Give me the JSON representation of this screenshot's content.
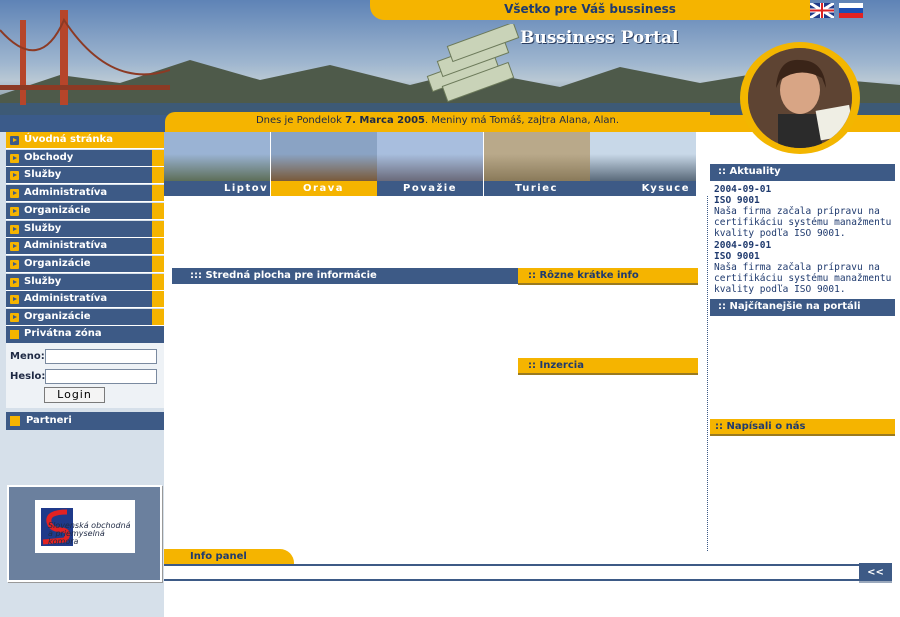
{
  "header": {
    "tagline": "Všetko pre Váš bussiness",
    "brand": "Bussiness Portal",
    "date_prefix": "Dnes je Pondelok ",
    "date_value": "7. Marca 2005",
    "date_suffix": ". Meniny má Tomáš, zajtra Alana, Alan.",
    "flags": [
      "english-flag",
      "slovak-flag"
    ]
  },
  "nav": {
    "items": [
      {
        "label": "Úvodná stránka",
        "active": true
      },
      {
        "label": "Obchody"
      },
      {
        "label": "Služby"
      },
      {
        "label": "Administratíva"
      },
      {
        "label": "Organizácie"
      },
      {
        "label": "Služby"
      },
      {
        "label": "Administratíva"
      },
      {
        "label": "Organizácie"
      },
      {
        "label": "Služby"
      },
      {
        "label": "Administratíva"
      },
      {
        "label": "Organizácie"
      }
    ],
    "private_zone": "Privátna zóna"
  },
  "login": {
    "name_label": "Meno:",
    "password_label": "Heslo:",
    "name_value": "",
    "password_value": "",
    "button": "Login"
  },
  "partners": {
    "title": "Partneri",
    "logo_text": "Slovenská obchodná a priemyselná komora"
  },
  "regions": [
    {
      "label": "Liptov"
    },
    {
      "label": "Orava",
      "active": true
    },
    {
      "label": "Považie"
    },
    {
      "label": "Turiec"
    },
    {
      "label": "Kysuce"
    }
  ],
  "center": {
    "main_title": "::: Stredná plocha pre informácie",
    "short_info_title": ":: Rôzne krátke info",
    "ads_title": ":: Inzercia"
  },
  "right": {
    "news_title": ":: Aktuality",
    "news": [
      {
        "date": "2004-09-01",
        "title": "ISO 9001",
        "text": "Naša firma začala prípravu na certifikáciu systému manažmentu kvality podľa ISO 9001."
      },
      {
        "date": "2004-09-01",
        "title": "ISO 9001",
        "text": "Naša firma začala prípravu na certifikáciu systému manažmentu kvality podľa ISO 9001."
      }
    ],
    "most_read_title": ":: Najčítanejšie na portáli",
    "wrote_about_title": ":: Napísali o nás"
  },
  "info_panel": {
    "title": "Info panel",
    "button": "<<"
  },
  "colors": {
    "navy": "#3d5a86",
    "orange": "#f5b400",
    "light_blue": "#d6e0ea"
  }
}
